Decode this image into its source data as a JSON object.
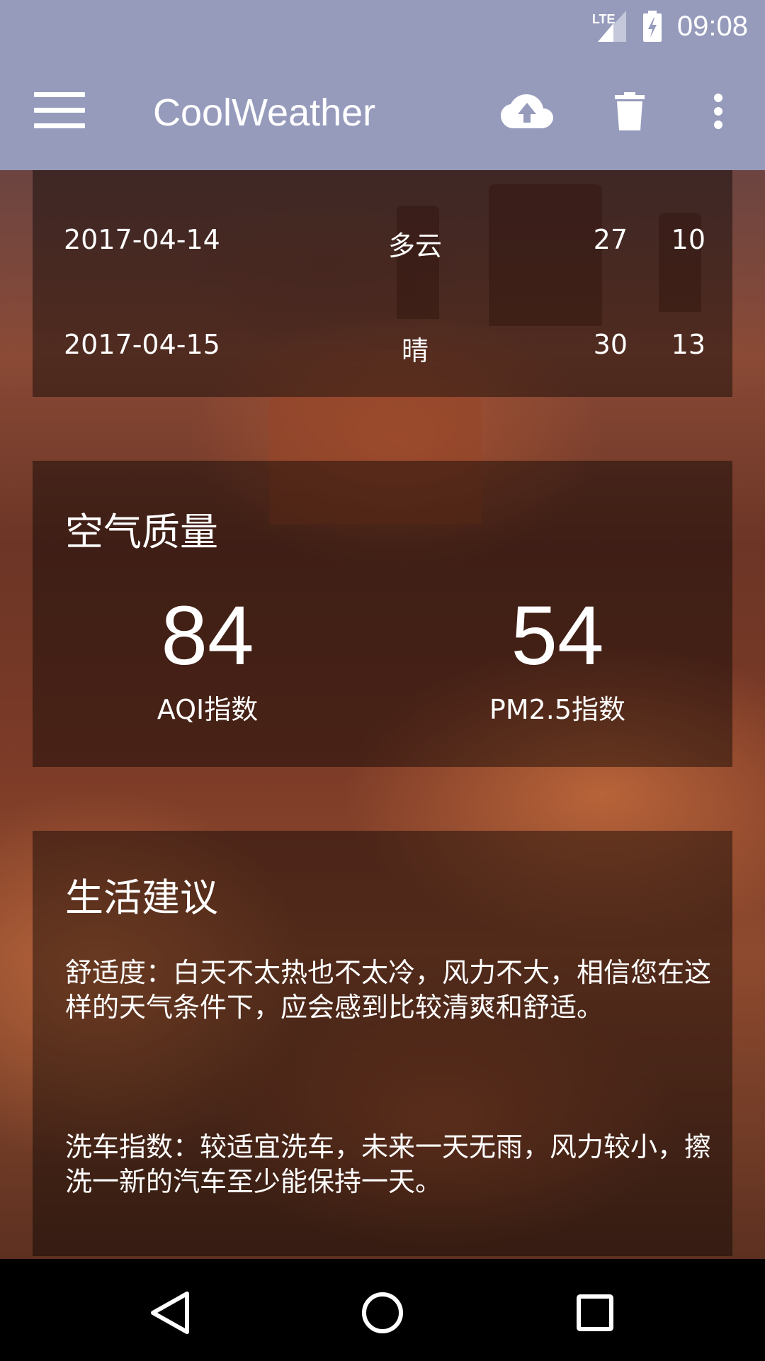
{
  "status_bar": {
    "network": "LTE",
    "time": "09:08",
    "icons": [
      "lte-signal-icon",
      "battery-charging-icon"
    ]
  },
  "toolbar": {
    "title": "CoolWeather",
    "icons": [
      "menu-icon",
      "cloud-upload-icon",
      "trash-icon",
      "more-vert-icon"
    ]
  },
  "forecast": {
    "rows": [
      {
        "date": "2017-04-14",
        "info": "多云",
        "max": "27",
        "min": "10"
      },
      {
        "date": "2017-04-15",
        "info": "晴",
        "max": "30",
        "min": "13"
      }
    ]
  },
  "aqi": {
    "title": "空气质量",
    "aqi_value": "84",
    "aqi_label": "AQI指数",
    "pm25_value": "54",
    "pm25_label": "PM2.5指数"
  },
  "suggestion": {
    "title": "生活建议",
    "comfort": "舒适度：白天不太热也不太冷，风力不大，相信您在这样的天气条件下，应会感到比较清爽和舒适。",
    "car_wash": "洗车指数：较适宜洗车，未来一天无雨，风力较小，擦洗一新的汽车至少能保持一天。"
  },
  "nav_bar": {
    "icons": [
      "back-icon",
      "home-icon",
      "recents-icon"
    ]
  },
  "colors": {
    "toolbar": "#969bbc",
    "card_overlay": "rgba(0,0,0,0.42)",
    "nav_bar": "#000000"
  }
}
